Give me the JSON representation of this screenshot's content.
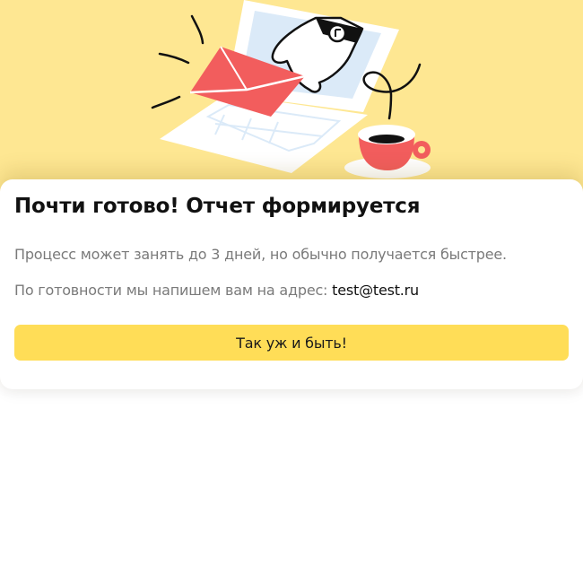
{
  "dialog": {
    "title": "Почти готово! Отчет формируется",
    "message_line1": "Процесс может занять до 3 дней, но обычно получается быстрее.",
    "message_line2_prefix": "По готовности мы напишем вам на адрес: ",
    "email": "test@test.ru",
    "button_label": "Так уж и быть!"
  },
  "colors": {
    "hero_background": "#fee792",
    "accent_button": "#ffdd57",
    "envelope": "#f25d5d",
    "cup": "#f25d5d",
    "title_text": "#111111",
    "secondary_text": "#7a7a7a"
  },
  "icons": [
    "laptop-illustration",
    "envelope-icon",
    "hand-icon",
    "coffee-cup-icon"
  ]
}
